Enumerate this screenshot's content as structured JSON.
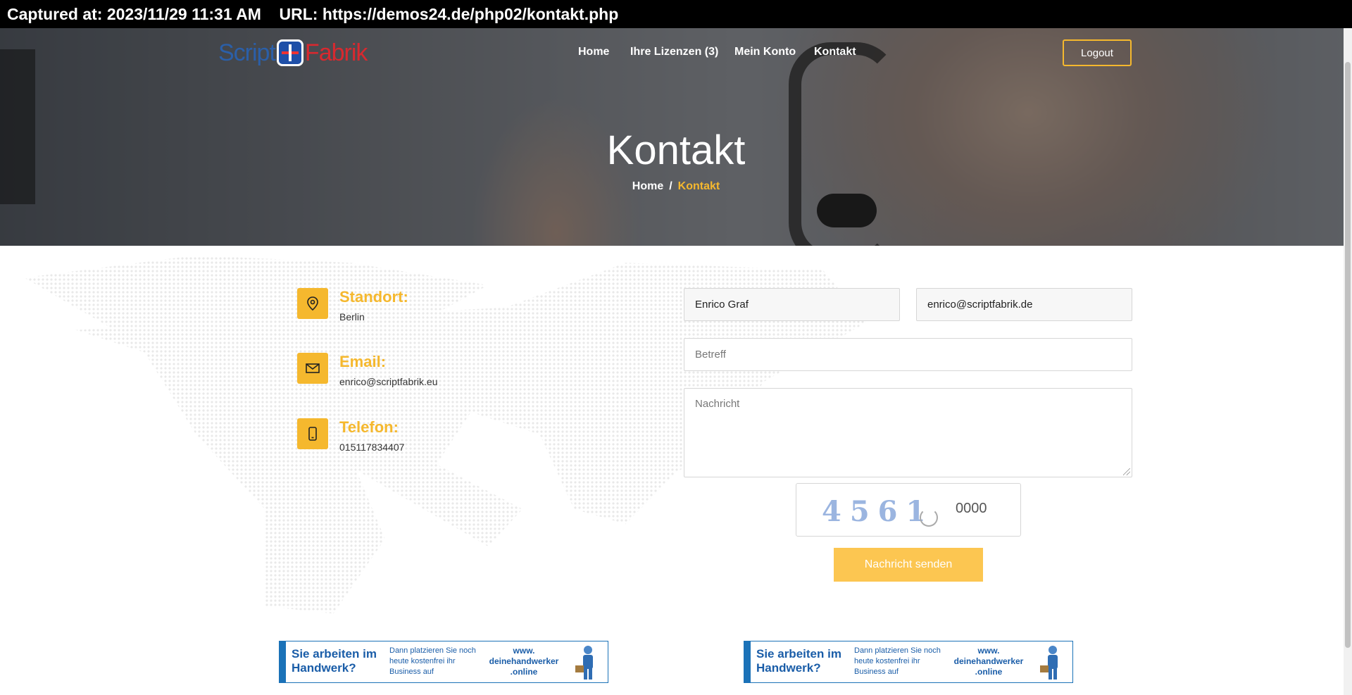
{
  "capture": {
    "captured_label": "Captured at: 2023/11/29 11:31 AM",
    "url_label": "URL: https://demos24.de/php02/kontakt.php"
  },
  "header": {
    "logo": {
      "part1": "Script",
      "part2": "Fabrik"
    },
    "nav": [
      {
        "label": "Home"
      },
      {
        "label": "Ihre Lizenzen (3)"
      },
      {
        "label": "Mein Konto"
      },
      {
        "label": "Kontakt"
      }
    ],
    "logout_label": "Logout"
  },
  "hero": {
    "title": "Kontakt",
    "breadcrumb": {
      "home": "Home",
      "separator": "/",
      "current": "Kontakt"
    }
  },
  "contact_info": [
    {
      "icon": "location-pin-icon",
      "title": "Standort:",
      "value": "Berlin"
    },
    {
      "icon": "envelope-icon",
      "title": "Email:",
      "value": "enrico@scriptfabrik.eu"
    },
    {
      "icon": "mobile-phone-icon",
      "title": "Telefon:",
      "value": "015117834407"
    }
  ],
  "form": {
    "name_value": "Enrico Graf",
    "email_value": "enrico@scriptfabrik.de",
    "subject_placeholder": "Betreff",
    "message_placeholder": "Nachricht",
    "captcha_code": "4561",
    "captcha_input_value": "0000",
    "submit_label": "Nachricht senden"
  },
  "banners": [
    {
      "headline": "Sie arbeiten im Handwerk?",
      "subtext": "Dann platzieren Sie noch heute kostenfrei ihr Business auf",
      "url": "www. deinehandwerker .online"
    },
    {
      "headline": "Sie arbeiten im Handwerk?",
      "subtext": "Dann platzieren Sie noch heute kostenfrei ihr Business auf",
      "url": "www. deinehandwerker .online"
    }
  ],
  "colors": {
    "accent": "#f5b82e",
    "button": "#fcc651",
    "banner_blue": "#1b72b8"
  }
}
